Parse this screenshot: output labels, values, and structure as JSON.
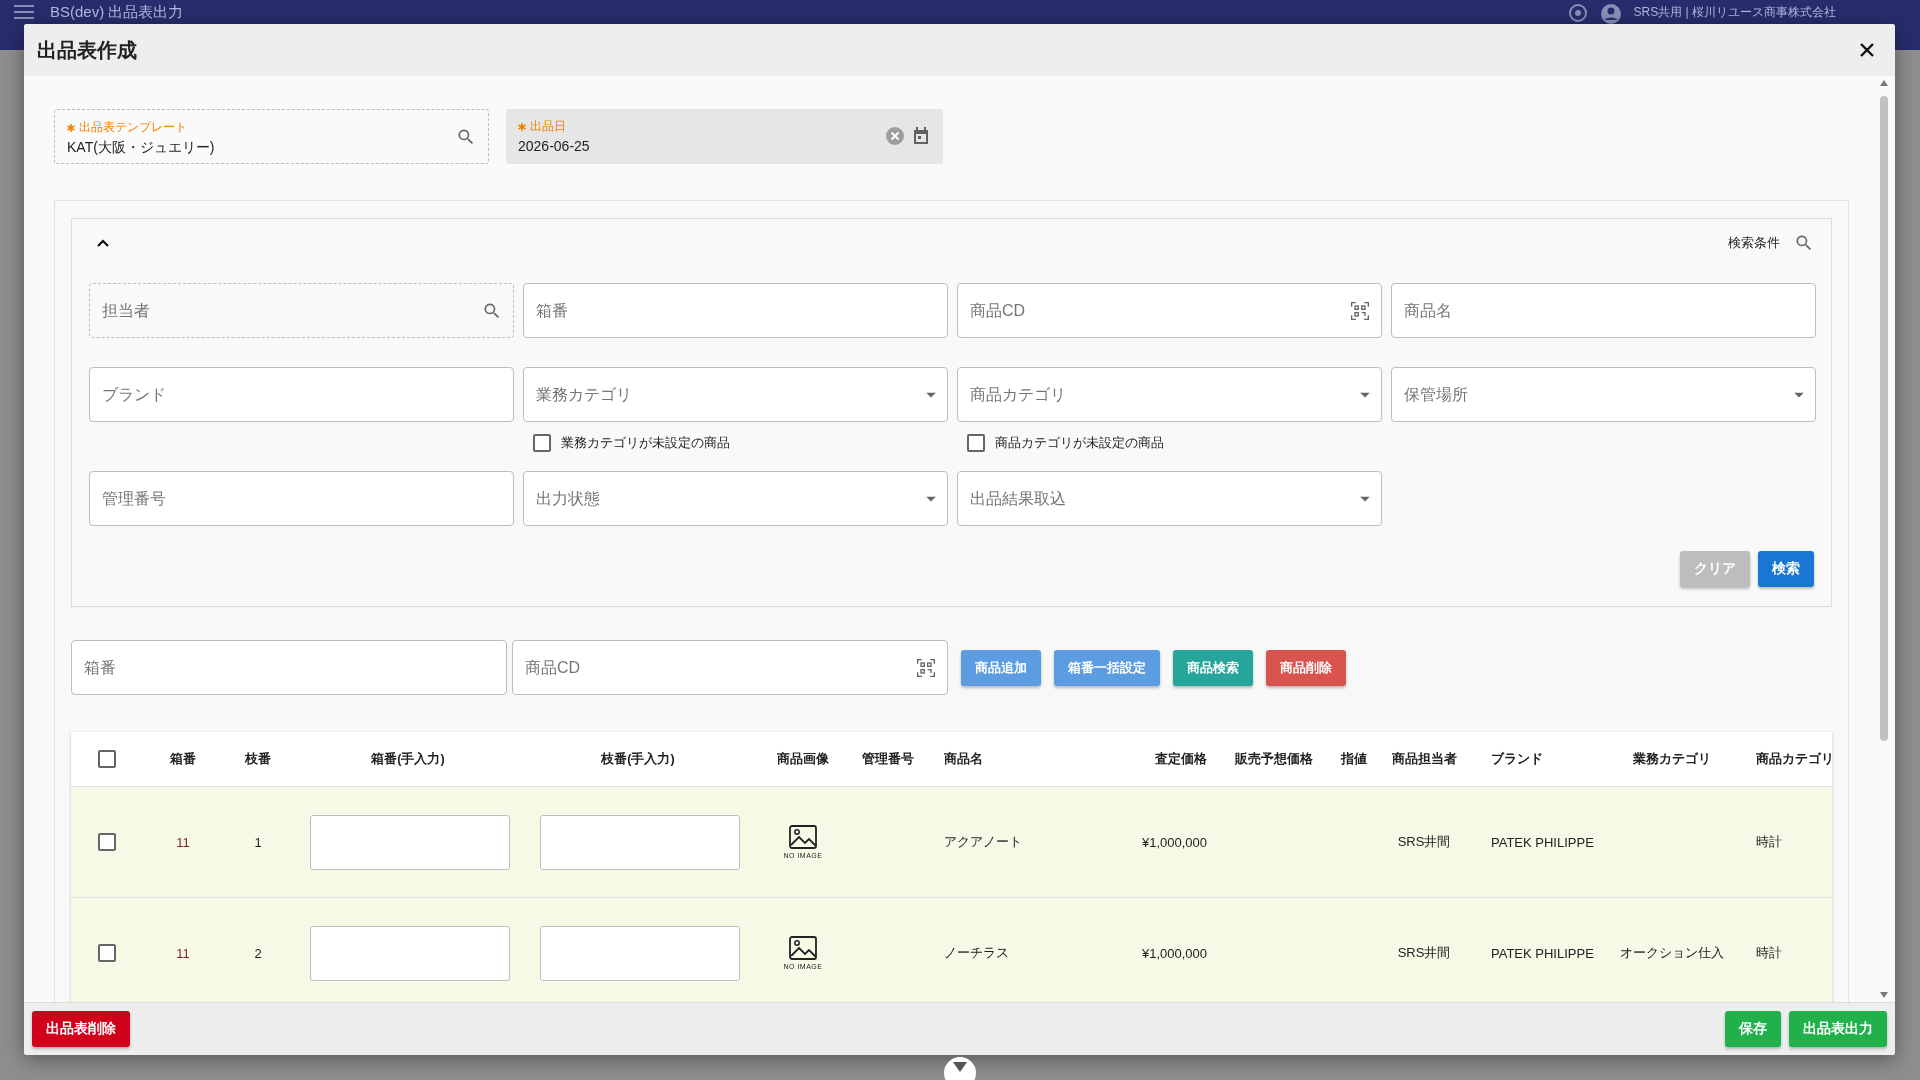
{
  "app_bar": {
    "title": "BS(dev) 出品表出力",
    "user": "SRS共用 | 桜川リユース商事株式会社"
  },
  "dialog": {
    "title": "出品表作成"
  },
  "header_fields": [
    {
      "kind": "lookup",
      "label": "出品表テンプレート",
      "required": true,
      "value": "KAT(大阪・ジュエリー)"
    },
    {
      "kind": "date",
      "label": "出品日",
      "required": true,
      "value": "2026-06-25"
    }
  ],
  "search_panel": {
    "expanded": true,
    "title": "検索条件",
    "rows": [
      [
        {
          "kind": "lookup",
          "placeholder": "担当者"
        },
        {
          "kind": "text",
          "placeholder": "箱番"
        },
        {
          "kind": "scan",
          "placeholder": "商品CD"
        },
        {
          "kind": "text",
          "placeholder": "商品名"
        }
      ],
      [
        {
          "kind": "text",
          "placeholder": "ブランド"
        },
        {
          "kind": "select",
          "placeholder": "業務カテゴリ",
          "checkbox": {
            "label": "業務カテゴリが未設定の商品",
            "checked": false
          }
        },
        {
          "kind": "select",
          "placeholder": "商品カテゴリ",
          "checkbox": {
            "label": "商品カテゴリが未設定の商品",
            "checked": false
          }
        },
        {
          "kind": "select",
          "placeholder": "保管場所"
        }
      ],
      [
        {
          "kind": "text",
          "placeholder": "管理番号"
        },
        {
          "kind": "select",
          "placeholder": "出力状態"
        },
        {
          "kind": "select",
          "placeholder": "出品結果取込"
        }
      ]
    ],
    "buttons": [
      {
        "kind": "secondary",
        "label": "クリア"
      },
      {
        "kind": "primary",
        "label": "検索"
      }
    ]
  },
  "add_bar": {
    "fields": [
      {
        "kind": "text",
        "placeholder": "箱番"
      },
      {
        "kind": "scan",
        "placeholder": "商品CD"
      }
    ],
    "buttons": [
      {
        "label": "商品追加",
        "color": "#5b9de0"
      },
      {
        "label": "箱番一括設定",
        "color": "#5b9de0"
      },
      {
        "label": "商品検索",
        "color": "#26a69a"
      },
      {
        "label": "商品削除",
        "color": "#d9534f"
      }
    ]
  },
  "table": {
    "all_selected": false,
    "columns": [
      "箱番",
      "枝番",
      "箱番(手入力)",
      "枝番(手入力)",
      "商品画像",
      "管理番号",
      "商品名",
      "査定価格",
      "販売予想価格",
      "指値",
      "商品担当者",
      "ブランド",
      "業務カテゴリ",
      "商品カテゴリ"
    ],
    "rows": [
      {
        "selected": false,
        "box_no": "11",
        "branch_no": "1",
        "image_label": "NO IMAGE",
        "product_name": "アクアノート",
        "appraisal_price": "¥1,000,000",
        "staff": "SRS井間",
        "brand": "PATEK PHILIPPE",
        "product_category": "時計"
      },
      {
        "selected": false,
        "box_no": "11",
        "branch_no": "2",
        "image_label": "NO IMAGE",
        "product_name": "ノーチラス",
        "appraisal_price": "¥1,000,000",
        "staff": "SRS井間",
        "brand": "PATEK PHILIPPE",
        "business_category": "オークション仕入",
        "product_category": "時計"
      }
    ]
  },
  "footer": {
    "buttons": [
      {
        "kind": "danger",
        "label": "出品表削除"
      },
      {
        "kind": "success",
        "label": "保存"
      },
      {
        "kind": "success",
        "label": "出品表出力"
      }
    ]
  }
}
